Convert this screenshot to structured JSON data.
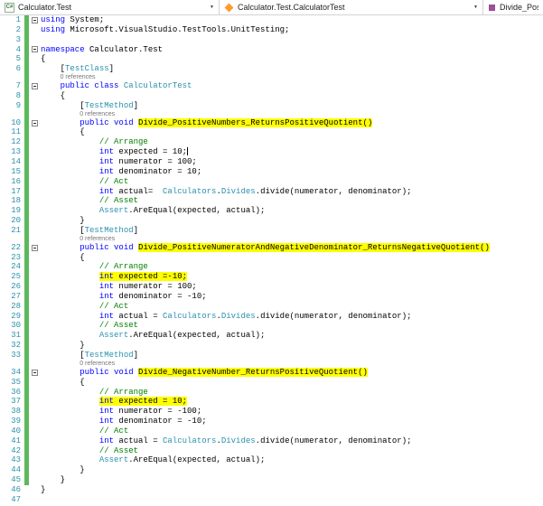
{
  "navbar": {
    "project": "Calculator.Test",
    "type": "Calculator.Test.CalculatorTest",
    "member": "Divide_Positi"
  },
  "icons": {
    "project": "csharp-test-project-icon",
    "type": "class-icon",
    "member": "method-icon",
    "dropdown": "chevron-down-icon"
  },
  "colors": {
    "keyword": "#0000ff",
    "type_name": "#2b91af",
    "comment": "#008000",
    "highlight": "#ffff00",
    "change_bar": "#5cb85c",
    "line_number": "#2b91af",
    "codelens": "#767676"
  },
  "code": {
    "lines": [
      {
        "n": 1,
        "changed": true,
        "fold": true,
        "segs": [
          {
            "t": "kw",
            "x": "using"
          },
          {
            "t": "pl",
            "x": " System;"
          }
        ]
      },
      {
        "n": 2,
        "changed": true,
        "segs": [
          {
            "t": "kw",
            "x": "using"
          },
          {
            "t": "pl",
            "x": " Microsoft.VisualStudio.TestTools.UnitTesting;"
          }
        ]
      },
      {
        "n": 3,
        "changed": true,
        "segs": []
      },
      {
        "n": 4,
        "changed": true,
        "fold": true,
        "segs": [
          {
            "t": "kw",
            "x": "namespace"
          },
          {
            "t": "pl",
            "x": " Calculator.Test"
          }
        ]
      },
      {
        "n": 5,
        "changed": true,
        "segs": [
          {
            "t": "pl",
            "x": "{"
          }
        ]
      },
      {
        "n": 6,
        "changed": true,
        "segs": [
          {
            "t": "pl",
            "x": "    ["
          },
          {
            "t": "ty",
            "x": "TestClass"
          },
          {
            "t": "pl",
            "x": "]"
          }
        ]
      },
      {
        "n": 7,
        "changed": true,
        "fold": true,
        "lens": "0 references",
        "lens_indent": 4,
        "segs": [
          {
            "t": "pl",
            "x": "    "
          },
          {
            "t": "kw",
            "x": "public class"
          },
          {
            "t": "pl",
            "x": " "
          },
          {
            "t": "ty",
            "x": "CalculatorTest"
          }
        ]
      },
      {
        "n": 8,
        "changed": true,
        "segs": [
          {
            "t": "pl",
            "x": "    {"
          }
        ]
      },
      {
        "n": 9,
        "changed": true,
        "segs": [
          {
            "t": "pl",
            "x": "        ["
          },
          {
            "t": "ty",
            "x": "TestMethod"
          },
          {
            "t": "pl",
            "x": "]"
          }
        ]
      },
      {
        "n": 10,
        "changed": true,
        "fold": true,
        "lens": "0 references",
        "lens_indent": 8,
        "segs": [
          {
            "t": "pl",
            "x": "        "
          },
          {
            "t": "kw",
            "x": "public void"
          },
          {
            "t": "pl",
            "x": " "
          },
          {
            "t": "pl",
            "h": true,
            "x": "Divide_PositiveNumbers_ReturnsPositiveQuotient()"
          }
        ]
      },
      {
        "n": 11,
        "changed": true,
        "segs": [
          {
            "t": "pl",
            "x": "        {"
          }
        ]
      },
      {
        "n": 12,
        "changed": true,
        "segs": [
          {
            "t": "pl",
            "x": "            "
          },
          {
            "t": "cm",
            "x": "// Arrange"
          }
        ]
      },
      {
        "n": 13,
        "changed": true,
        "caret": true,
        "segs": [
          {
            "t": "pl",
            "x": "            "
          },
          {
            "t": "kw",
            "x": "int"
          },
          {
            "t": "pl",
            "x": " expected = 10;"
          }
        ]
      },
      {
        "n": 14,
        "changed": true,
        "segs": [
          {
            "t": "pl",
            "x": "            "
          },
          {
            "t": "kw",
            "x": "int"
          },
          {
            "t": "pl",
            "x": " numerator = 100;"
          }
        ]
      },
      {
        "n": 15,
        "changed": true,
        "segs": [
          {
            "t": "pl",
            "x": "            "
          },
          {
            "t": "kw",
            "x": "int"
          },
          {
            "t": "pl",
            "x": " denominator = 10;"
          }
        ]
      },
      {
        "n": 16,
        "changed": true,
        "segs": [
          {
            "t": "pl",
            "x": "            "
          },
          {
            "t": "cm",
            "x": "// Act"
          }
        ]
      },
      {
        "n": 17,
        "changed": true,
        "segs": [
          {
            "t": "pl",
            "x": "            "
          },
          {
            "t": "kw",
            "x": "int"
          },
          {
            "t": "pl",
            "x": " actual=  "
          },
          {
            "t": "ty",
            "x": "Calculators"
          },
          {
            "t": "pl",
            "x": "."
          },
          {
            "t": "ty",
            "x": "Divides"
          },
          {
            "t": "pl",
            "x": ".divide(numerator, denominator);"
          }
        ]
      },
      {
        "n": 18,
        "changed": true,
        "segs": [
          {
            "t": "pl",
            "x": "            "
          },
          {
            "t": "cm",
            "x": "// Asset"
          }
        ]
      },
      {
        "n": 19,
        "changed": true,
        "segs": [
          {
            "t": "pl",
            "x": "            "
          },
          {
            "t": "ty",
            "x": "Assert"
          },
          {
            "t": "pl",
            "x": ".AreEqual(expected, actual);"
          }
        ]
      },
      {
        "n": 20,
        "changed": true,
        "segs": [
          {
            "t": "pl",
            "x": "        }"
          }
        ]
      },
      {
        "n": 21,
        "changed": true,
        "segs": [
          {
            "t": "pl",
            "x": "        ["
          },
          {
            "t": "ty",
            "x": "TestMethod"
          },
          {
            "t": "pl",
            "x": "]"
          }
        ]
      },
      {
        "n": 22,
        "changed": true,
        "fold": true,
        "lens": "0 references",
        "lens_indent": 8,
        "segs": [
          {
            "t": "pl",
            "x": "        "
          },
          {
            "t": "kw",
            "x": "public void"
          },
          {
            "t": "pl",
            "x": " "
          },
          {
            "t": "pl",
            "h": true,
            "x": "Divide_PositiveNumeratorAndNegativeDenominator_ReturnsNegativeQuotient()"
          }
        ]
      },
      {
        "n": 23,
        "changed": true,
        "segs": [
          {
            "t": "pl",
            "x": "        {"
          }
        ]
      },
      {
        "n": 24,
        "changed": true,
        "segs": [
          {
            "t": "pl",
            "x": "            "
          },
          {
            "t": "cm",
            "x": "// Arrange"
          }
        ]
      },
      {
        "n": 25,
        "changed": true,
        "segs": [
          {
            "t": "pl",
            "x": "            "
          },
          {
            "t": "kw",
            "h": true,
            "x": "int"
          },
          {
            "t": "pl",
            "h": true,
            "x": " expected =-10;"
          }
        ]
      },
      {
        "n": 26,
        "changed": true,
        "segs": [
          {
            "t": "pl",
            "x": "            "
          },
          {
            "t": "kw",
            "x": "int"
          },
          {
            "t": "pl",
            "x": " numerator = 100;"
          }
        ]
      },
      {
        "n": 27,
        "changed": true,
        "segs": [
          {
            "t": "pl",
            "x": "            "
          },
          {
            "t": "kw",
            "x": "int"
          },
          {
            "t": "pl",
            "x": " denominator = -10;"
          }
        ]
      },
      {
        "n": 28,
        "changed": true,
        "segs": [
          {
            "t": "pl",
            "x": "            "
          },
          {
            "t": "cm",
            "x": "// Act"
          }
        ]
      },
      {
        "n": 29,
        "changed": true,
        "segs": [
          {
            "t": "pl",
            "x": "            "
          },
          {
            "t": "kw",
            "x": "int"
          },
          {
            "t": "pl",
            "x": " actual = "
          },
          {
            "t": "ty",
            "x": "Calculators"
          },
          {
            "t": "pl",
            "x": "."
          },
          {
            "t": "ty",
            "x": "Divides"
          },
          {
            "t": "pl",
            "x": ".divide(numerator, denominator);"
          }
        ]
      },
      {
        "n": 30,
        "changed": true,
        "segs": [
          {
            "t": "pl",
            "x": "            "
          },
          {
            "t": "cm",
            "x": "// Asset"
          }
        ]
      },
      {
        "n": 31,
        "changed": true,
        "segs": [
          {
            "t": "pl",
            "x": "            "
          },
          {
            "t": "ty",
            "x": "Assert"
          },
          {
            "t": "pl",
            "x": ".AreEqual(expected, actual);"
          }
        ]
      },
      {
        "n": 32,
        "changed": true,
        "segs": [
          {
            "t": "pl",
            "x": "        }"
          }
        ]
      },
      {
        "n": 33,
        "changed": true,
        "segs": [
          {
            "t": "pl",
            "x": "        ["
          },
          {
            "t": "ty",
            "x": "TestMethod"
          },
          {
            "t": "pl",
            "x": "]"
          }
        ]
      },
      {
        "n": 34,
        "changed": true,
        "fold": true,
        "lens": "0 references",
        "lens_indent": 8,
        "segs": [
          {
            "t": "pl",
            "x": "        "
          },
          {
            "t": "kw",
            "x": "public void"
          },
          {
            "t": "pl",
            "x": " "
          },
          {
            "t": "pl",
            "h": true,
            "x": "Divide_NegativeNumber_ReturnsPositiveQuotient()"
          }
        ]
      },
      {
        "n": 35,
        "changed": true,
        "segs": [
          {
            "t": "pl",
            "x": "        {"
          }
        ]
      },
      {
        "n": 36,
        "changed": true,
        "segs": [
          {
            "t": "pl",
            "x": "            "
          },
          {
            "t": "cm",
            "x": "// Arrange"
          }
        ]
      },
      {
        "n": 37,
        "changed": true,
        "segs": [
          {
            "t": "pl",
            "x": "            "
          },
          {
            "t": "kw",
            "h": true,
            "x": "int"
          },
          {
            "t": "pl",
            "h": true,
            "x": " expected = 10;"
          }
        ]
      },
      {
        "n": 38,
        "changed": true,
        "segs": [
          {
            "t": "pl",
            "x": "            "
          },
          {
            "t": "kw",
            "x": "int"
          },
          {
            "t": "pl",
            "x": " numerator = -100;"
          }
        ]
      },
      {
        "n": 39,
        "changed": true,
        "segs": [
          {
            "t": "pl",
            "x": "            "
          },
          {
            "t": "kw",
            "x": "int"
          },
          {
            "t": "pl",
            "x": " denominator = -10;"
          }
        ]
      },
      {
        "n": 40,
        "changed": true,
        "segs": [
          {
            "t": "pl",
            "x": "            "
          },
          {
            "t": "cm",
            "x": "// Act"
          }
        ]
      },
      {
        "n": 41,
        "changed": true,
        "segs": [
          {
            "t": "pl",
            "x": "            "
          },
          {
            "t": "kw",
            "x": "int"
          },
          {
            "t": "pl",
            "x": " actual = "
          },
          {
            "t": "ty",
            "x": "Calculators"
          },
          {
            "t": "pl",
            "x": "."
          },
          {
            "t": "ty",
            "x": "Divides"
          },
          {
            "t": "pl",
            "x": ".divide(numerator, denominator);"
          }
        ]
      },
      {
        "n": 42,
        "changed": true,
        "segs": [
          {
            "t": "pl",
            "x": "            "
          },
          {
            "t": "cm",
            "x": "// Asset"
          }
        ]
      },
      {
        "n": 43,
        "changed": true,
        "segs": [
          {
            "t": "pl",
            "x": "            "
          },
          {
            "t": "ty",
            "x": "Assert"
          },
          {
            "t": "pl",
            "x": ".AreEqual(expected, actual);"
          }
        ]
      },
      {
        "n": 44,
        "changed": true,
        "segs": [
          {
            "t": "pl",
            "x": "        }"
          }
        ]
      },
      {
        "n": 45,
        "changed": true,
        "segs": [
          {
            "t": "pl",
            "x": "    }"
          }
        ]
      },
      {
        "n": 46,
        "changed": false,
        "segs": [
          {
            "t": "pl",
            "x": "}"
          }
        ]
      },
      {
        "n": 47,
        "changed": false,
        "segs": []
      }
    ]
  }
}
